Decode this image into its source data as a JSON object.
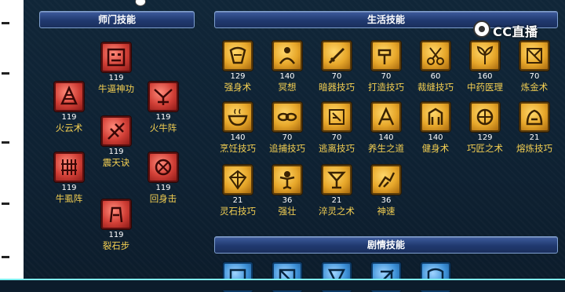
{
  "panels": {
    "sect": {
      "title": "师门技能"
    },
    "life": {
      "title": "生活技能"
    },
    "story": {
      "title": "剧情技能"
    }
  },
  "sect_skills": [
    {
      "name": "牛逼神功",
      "level": "119",
      "icon": "demon-mask-icon"
    },
    {
      "name": "火云术",
      "level": "119",
      "icon": "fire-cloud-icon"
    },
    {
      "name": "火牛阵",
      "level": "119",
      "icon": "fire-bull-icon"
    },
    {
      "name": "震天诀",
      "level": "119",
      "icon": "thunder-slash-icon"
    },
    {
      "name": "牛虱阵",
      "level": "119",
      "icon": "bull-formation-icon"
    },
    {
      "name": "回身击",
      "level": "119",
      "icon": "turn-strike-icon"
    },
    {
      "name": "裂石步",
      "level": "119",
      "icon": "stone-split-icon"
    }
  ],
  "life_skills": [
    {
      "name": "强身术",
      "level": "129",
      "icon": "body-strength-icon"
    },
    {
      "name": "冥想",
      "level": "140",
      "icon": "meditation-icon"
    },
    {
      "name": "暗器技巧",
      "level": "70",
      "icon": "dagger-icon"
    },
    {
      "name": "打造技巧",
      "level": "70",
      "icon": "hammer-icon"
    },
    {
      "name": "裁缝技巧",
      "level": "60",
      "icon": "scissors-icon"
    },
    {
      "name": "中药医理",
      "level": "160",
      "icon": "herb-icon"
    },
    {
      "name": "炼金术",
      "level": "70",
      "icon": "alchemy-icon"
    },
    {
      "name": "烹饪技巧",
      "level": "140",
      "icon": "cooking-icon"
    },
    {
      "name": "追捕技巧",
      "level": "70",
      "icon": "chain-icon"
    },
    {
      "name": "逃离技巧",
      "level": "70",
      "icon": "escape-icon"
    },
    {
      "name": "养生之道",
      "level": "140",
      "icon": "wellness-icon"
    },
    {
      "name": "健身术",
      "level": "140",
      "icon": "fitness-icon"
    },
    {
      "name": "巧匠之术",
      "level": "129",
      "icon": "craftsman-icon"
    },
    {
      "name": "熔炼技巧",
      "level": "21",
      "icon": "smelting-icon"
    },
    {
      "name": "灵石技巧",
      "level": "21",
      "icon": "spirit-stone-icon"
    },
    {
      "name": "强壮",
      "level": "36",
      "icon": "strong-icon"
    },
    {
      "name": "淬灵之术",
      "level": "21",
      "icon": "tempering-icon"
    },
    {
      "name": "神速",
      "level": "36",
      "icon": "swift-icon"
    }
  ],
  "story_skills": [
    {
      "icon": "story-skill-1-icon"
    },
    {
      "icon": "story-skill-2-icon"
    },
    {
      "icon": "story-skill-3-icon"
    },
    {
      "icon": "story-skill-4-icon"
    },
    {
      "icon": "story-skill-5-icon"
    }
  ],
  "watermark": {
    "text": "CC直播"
  },
  "colors": {
    "background": "#0d1e2d",
    "header": "#2a4785",
    "skill_name": "#f3cf52",
    "level_text": "#ffffff",
    "sect_icon": "#c73a32",
    "life_icon": "#e7a72a",
    "story_icon": "#3b8fd6",
    "divider": "#7ff0f0"
  }
}
